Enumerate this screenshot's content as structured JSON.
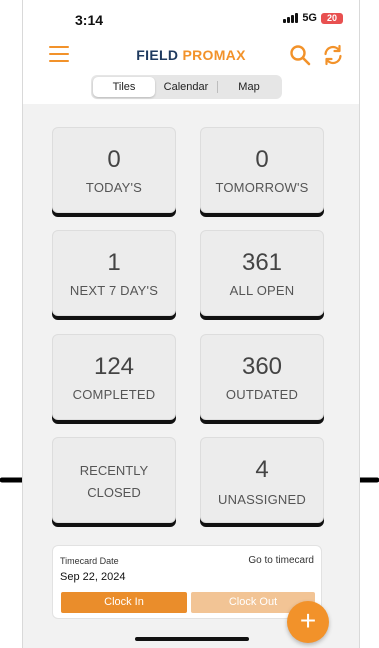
{
  "status_bar": {
    "time": "3:14",
    "network": "5G",
    "battery": "20"
  },
  "header": {
    "brand_part1": "FIELD",
    "brand_part2": "PROMAX",
    "menu_icon": "hamburger-icon",
    "search_icon": "search-icon",
    "sync_icon": "sync-icon"
  },
  "view_tabs": [
    {
      "label": "Tiles",
      "active": true
    },
    {
      "label": "Calendar",
      "active": false
    },
    {
      "label": "Map",
      "active": false
    }
  ],
  "tiles": [
    {
      "count": "0",
      "label": "TODAY'S"
    },
    {
      "count": "0",
      "label": "TOMORROW'S"
    },
    {
      "count": "1",
      "label": "NEXT 7 DAY'S"
    },
    {
      "count": "361",
      "label": "ALL OPEN"
    },
    {
      "count": "124",
      "label": "COMPLETED"
    },
    {
      "count": "360",
      "label": "OUTDATED"
    },
    {
      "label_line1": "RECENTLY",
      "label_line2": "CLOSED"
    },
    {
      "count": "4",
      "label": "UNASSIGNED"
    }
  ],
  "timecard": {
    "title": "Timecard Date",
    "link": "Go to timecard",
    "date": "Sep 22, 2024",
    "clock_in": "Clock In",
    "clock_out": "Clock Out"
  },
  "fab": {
    "symbol": "+"
  },
  "colors": {
    "accent": "#f2922a",
    "brand_dark": "#1f3a5f",
    "clock_in": "#ea8d2b",
    "clock_out_disabled": "#f2c495"
  }
}
